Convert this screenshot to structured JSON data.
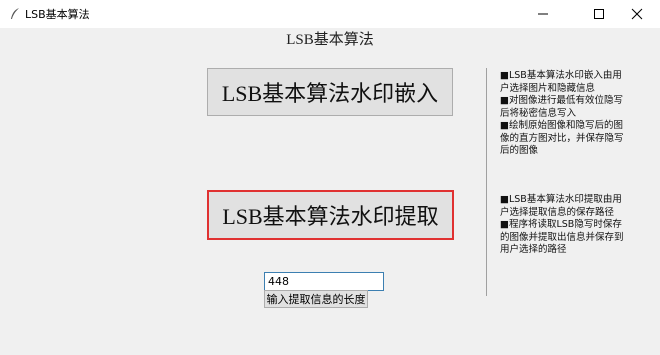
{
  "window": {
    "title": "LSB基本算法",
    "minimize_icon": "minimize-icon",
    "maximize_icon": "maximize-icon",
    "close_icon": "close-icon"
  },
  "main": {
    "title": "LSB基本算法",
    "embed_button": "LSB基本算法水印嵌入",
    "extract_button": "LSB基本算法水印提取",
    "length_input_value": "448",
    "length_button": "输入提取信息的长度",
    "highlight_color": "#e03131"
  },
  "descriptions": {
    "embed": "■LSB基本算法水印嵌入由用户选择图片和隐藏信息\n■对图像进行最低有效位隐写后将秘密信息写入\n■绘制原始图像和隐写后的图像的直方图对比，并保存隐写后的图像",
    "extract": "■LSB基本算法水印提取由用户选择提取信息的保存路径\n■程序将读取LSB隐写时保存的图像并提取出信息并保存到用户选择的路径"
  }
}
